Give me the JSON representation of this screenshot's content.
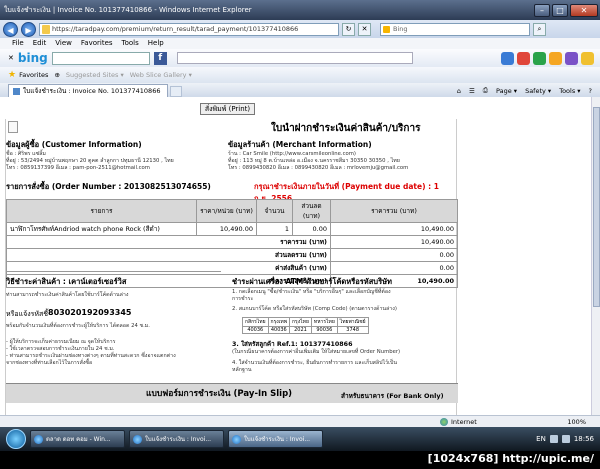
{
  "window": {
    "title": "ใบแจ้งชำระเงิน | Invoice No. 101377410866 - Windows Internet Explorer",
    "min": "–",
    "max": "□",
    "close": "✕"
  },
  "address": {
    "url": "https://taradpay.com/premium/return_result/tarad_payment/101377410866",
    "search_placeholder": "Bing"
  },
  "menu": [
    "File",
    "Edit",
    "View",
    "Favorites",
    "Tools",
    "Help"
  ],
  "favorites": {
    "label": "Favorites",
    "suggested": "Suggested Sites ▾",
    "gallery": "Web Slice Gallery ▾"
  },
  "tab": {
    "label": "ใบแจ้งชำระเงิน : Invoice No. 101377410866"
  },
  "commands": [
    "Page ▾",
    "Safety ▾",
    "Tools ▾",
    "?"
  ],
  "page": {
    "print_button": "สั่งพิมพ์ (Print)",
    "title": "ใบนำฝากชำระเงินค่าสินค้า/บริการ",
    "customer_heading": "ข้อมูลผู้ซื้อ (Customer Information)",
    "customer_lines": [
      "ชื่อ : ศิริพร แซ่ลิ้ม",
      "ที่อยู่ : 53/2494 หมู่บ้านพฤกษา 20 ตูคต ลำลูกกา ปทุมธานี 12130 , ไทย",
      "โทร : 0859137399 อีเมล : pam-pon-2511@hotmail.com"
    ],
    "merchant_heading": "ข้อมูลร้านค้า (Merchant Information)",
    "merchant_lines": [
      "ร้าน : Car Smile (http://www.carsmileonline.com)",
      "ที่อยู่ : 113 หมู่ 8 ต.บ้านเหล่อ อ.เมือง จ.นครราชสีมา 30350 30350 , ไทย",
      "โทร : 0899430820 อีเมล : 0899430820 อีเมล : mrlovemju@gmail.com"
    ],
    "order_label": "รายการสั่งซื้อ (Order Number : 2013082513074655)",
    "due_label": "กรุณาชำระเงินภายในวันที่ (Payment due date) : 1 ก.ย. 2556",
    "table_headers": [
      "รายการ",
      "ราคา/หน่วย (บาท)",
      "จำนวน",
      "ส่วนลด (บาท)",
      "ราคารวม (บาท)"
    ],
    "item": {
      "name": "นาฬิกาโทรศัพท์Andriod watch phone Rock (สีดำ)",
      "price": "10,490.00",
      "qty": "1",
      "discount": "0.00",
      "total": "10,490.00"
    },
    "summary": [
      {
        "label": "ราคารวม (บาท)",
        "value": "10,490.00"
      },
      {
        "label": "ส่วนลดรวม (บาท)",
        "value": "0.00"
      },
      {
        "label": "ค่าส่งสินค้า (บาท)",
        "value": "0.00"
      },
      {
        "label": "ราคารวมสุทธิ (บาท)",
        "value": "10,490.00"
      }
    ],
    "counter_heading": "วิธีชำระค่าสินค้า : เคาน์เตอร์เซอร์วิส",
    "counter_line1": "ท่านสามารถชำระเงินค่าสินค้าโดยใช้บาร์โค้ดด้านล่าง",
    "ref_label": "หรือแจ้งรหัสชี้",
    "ref_value": "803020192093345",
    "counter_line2": "พร้อมกับจำนวนเงินที่ต้องการชำระผู้ให้บริการ ได้ตลอด 24 ช.ม.",
    "counter_notes": [
      "- ผู้ให้บริการจะเก็บค่าธรรมเนียม ณ จุดให้บริการ",
      "- ใช้เวลาตรวจสอบการชำระเงินภายใน 24 ช.ม.",
      "- ท่านสามารถชำระเงินผ่านช่องทางต่างๆ ตามที่ท่านสะดวก ซึ่งอาจแตกต่าง",
      "  จากช่องทางที่ท่านเลือกไว้ในการสั่งซื้อ"
    ],
    "atm_heading": "ชำระผ่านเครื่อง ATM ด้วยบาร์โค้ดหรือรหัสบริษัท",
    "atm_steps": [
      "1. กดเลือกเมนู \"ซื้อ/ชำระเงิน\" หรือ \"บริการอื่นๆ\" และเลือกบัญชีที่ต้อง",
      "    การชำระ",
      "2. สแกนบาร์โค้ด หรือใส่รหัสบริษัท (Comp Code) (ตามตารางด้านล่าง)"
    ],
    "slip_headers": [
      "กสิกรไทย",
      "กรุงเทพ",
      "กรุงไทย",
      "ทหารไทย",
      "ไทยพาณิชย์"
    ],
    "slip_values": [
      "40036",
      "40036",
      "2021",
      "90036",
      "3748"
    ],
    "atm_ref_label": "3. ใส่หรัสลูกค้า Ref.1: 101377410866",
    "atm_ref_note": "(ในกรณีธนาคารต้องการค่าอื่นเพิ่มเติม ให้ใส่หมายเลขที่ Order Number)",
    "atm_step4": "4. ใส่จำนวนเงินที่ต้องการชำระ, ยืนยันการทำรายการ และเก็บสลิปไว้เป็น",
    "atm_step4b": "    หลักฐาน",
    "payslip_title": "แบบฟอร์มการชำระเงิน (Pay-In Slip)",
    "bank_only": "สำหรับธนาคาร (For Bank Only)"
  },
  "status": {
    "zone": "Internet",
    "zoom": "100%"
  },
  "taskbar": {
    "buttons": [
      "ตลาด ดอท คอม - Win...",
      "ใบแจ้งชำระเงิน : Invoi...",
      "ใบแจ้งชำระเงิน : Invoi..."
    ],
    "lang": "EN",
    "time": "18:56"
  },
  "watermark": "[1024x768] http://upic.me/"
}
